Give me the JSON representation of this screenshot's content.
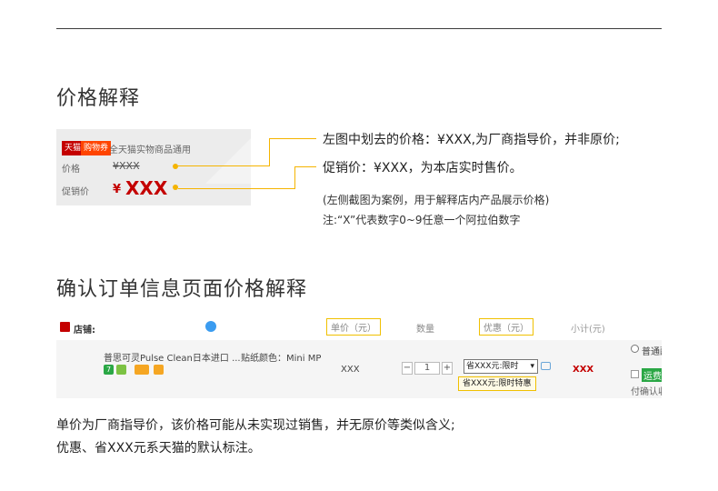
{
  "section1": {
    "title": "价格解释",
    "card": {
      "badge_tmall": "天猫",
      "badge_coupon": "购物券",
      "coupon_text": "全天猫实物商品通用",
      "price_label": "价格",
      "price_value": "¥XXX",
      "promo_label": "促销价",
      "promo_currency": "¥",
      "promo_value": "XXX"
    },
    "annotation_line1": "左图中划去的价格：¥XXX,为厂商指导价，并非原价;",
    "annotation_line2": "促销价：¥XXX，为本店实时售价。",
    "note_line1": "(左侧截图为案例，用于解释店内产品展示价格)",
    "note_line2": "注:“X”代表数字0~9任意一个阿拉伯数字"
  },
  "section2": {
    "title": "确认订单信息页面价格解释",
    "table": {
      "shop_label": "店铺:",
      "headers": {
        "unit_price": "单价（元）",
        "quantity": "数量",
        "discount": "优惠（元）",
        "subtotal": "小计(元)"
      },
      "row": {
        "product_name": "普思可灵Pulse Clean日本进口 ...",
        "spec": "贴纸颜色：Mini MP",
        "unit_price": "XXX",
        "quantity": "1",
        "minus": "−",
        "plus": "+",
        "discount_select": "省XXX元:限时",
        "discount_tip": "省XXX元:限时特惠",
        "subtotal": "XXX",
        "shipping_option": "普通配",
        "green_label": "运费",
        "pay_text": "付确认收"
      }
    }
  },
  "footer": {
    "line1": "单价为厂商指导价，该价格可能从未实现过销售，并无原价等类似含义;",
    "line2": "优惠、省XXX元系天猫的默认标注。"
  },
  "colors": {
    "accent_yellow": "#f5b400",
    "price_red": "#c40000",
    "tmall_red": "#c40000",
    "coupon_orange": "#ff4400"
  }
}
